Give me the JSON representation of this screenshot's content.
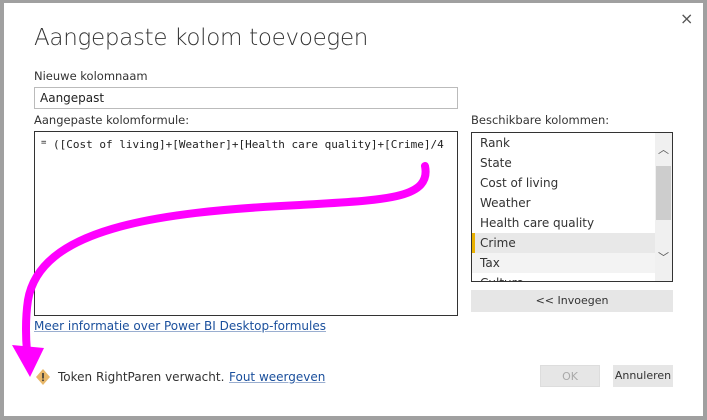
{
  "dialog": {
    "title": "Aangepaste kolom toevoegen",
    "close_icon": "×",
    "name_label": "Nieuwe kolomnaam",
    "name_value": "Aangepast",
    "formula_label": "Aangepaste kolomformule:",
    "formula_prefix": "=",
    "formula_value": "([Cost of living]+[Weather]+[Health care quality]+[Crime]/4",
    "columns_label": "Beschikbare kolommen:",
    "columns": [
      "Rank",
      "State",
      "Cost of living",
      "Weather",
      "Health care quality",
      "Crime",
      "Tax",
      "Culture"
    ],
    "selected_column": "Crime",
    "insert_button": "<< Invoegen",
    "help_link": "Meer informatie over Power BI Desktop-formules",
    "error_message": "Token RightParen verwacht.",
    "error_link": "Fout weergeven",
    "ok_button": "OK",
    "cancel_button": "Annuleren",
    "annotation_arrow_color": "#ff00ff",
    "warning_color": "#e8b86a"
  }
}
